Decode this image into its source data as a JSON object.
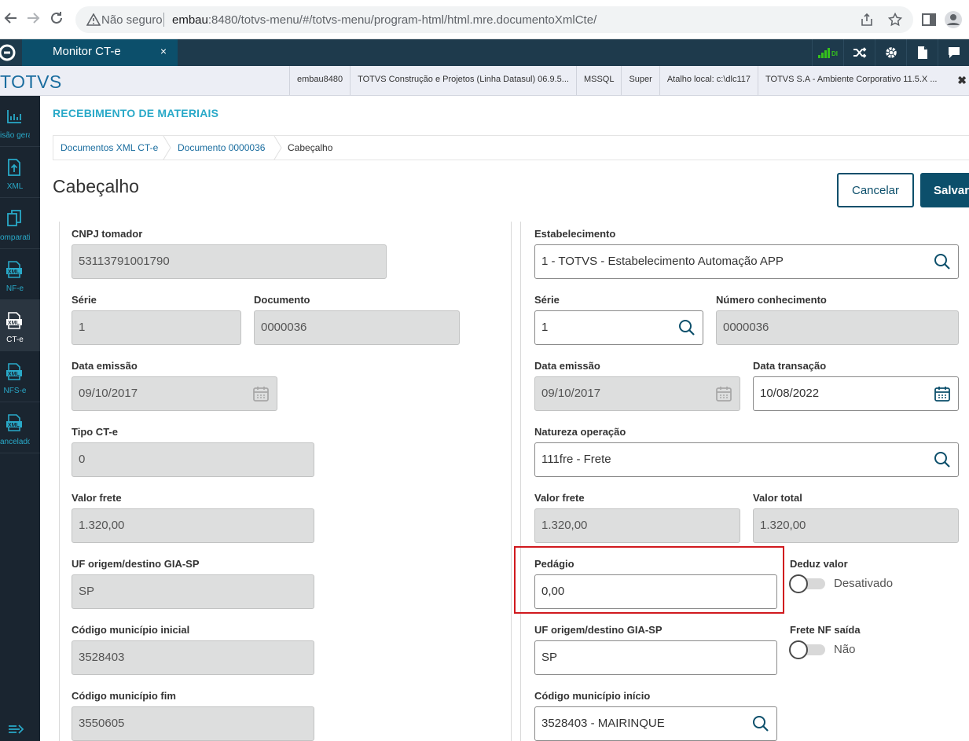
{
  "browser": {
    "insecure_label": "Não seguro",
    "url_host": "embau",
    "url_rest": ":8480/totvs-menu/#/totvs-menu/program-html/html.mre.documentoXmlCte/"
  },
  "header": {
    "tab_label": "Monitor CT-e",
    "tab_close": "×"
  },
  "infobar": {
    "logo": "TOTVS",
    "items": [
      "embau8480",
      "TOTVS Construção e Projetos (Linha Datasul) 06.9.5...",
      "MSSQL",
      "Super",
      "Atalho local: c:\\dlc117",
      "TOTVS S.A - Ambiente Corporativo 11.5.X ..."
    ],
    "close": "✖"
  },
  "sidebar": {
    "items": [
      {
        "label": "isão geral",
        "icon": "chart-icon"
      },
      {
        "label": "XML",
        "icon": "upload-icon"
      },
      {
        "label": "omparativo",
        "icon": "copy-icon"
      },
      {
        "label": "NF-e",
        "icon": "xml-file-icon"
      },
      {
        "label": "CT-e",
        "icon": "xml-file-icon"
      },
      {
        "label": "NFS-e",
        "icon": "xml-file-icon"
      },
      {
        "label": "ancelados",
        "icon": "xml-file-icon"
      }
    ]
  },
  "page": {
    "module_title": "RECEBIMENTO DE MATERIAIS",
    "breadcrumb": [
      "Documentos XML CT-e",
      "Documento 0000036",
      "Cabeçalho"
    ],
    "title": "Cabeçalho",
    "cancel_label": "Cancelar",
    "save_label": "Salvar"
  },
  "left": {
    "cnpj_label": "CNPJ tomador",
    "cnpj_value": "53113791001790",
    "serie_label": "Série",
    "serie_value": "1",
    "documento_label": "Documento",
    "documento_value": "0000036",
    "data_emissao_label": "Data emissão",
    "data_emissao_value": "09/10/2017",
    "tipo_cte_label": "Tipo CT-e",
    "tipo_cte_value": "0",
    "valor_frete_label": "Valor frete",
    "valor_frete_value": "1.320,00",
    "uf_label": "UF origem/destino GIA-SP",
    "uf_value": "SP",
    "cod_mun_ini_label": "Código município inicial",
    "cod_mun_ini_value": "3528403",
    "cod_mun_fim_label": "Código município fim",
    "cod_mun_fim_value": "3550605"
  },
  "right": {
    "estab_label": "Estabelecimento",
    "estab_value": "1 - TOTVS - Estabelecimento Automação APP",
    "serie_label": "Série",
    "serie_value": "1",
    "num_conh_label": "Número conhecimento",
    "num_conh_value": "0000036",
    "data_emissao_label": "Data emissão",
    "data_emissao_value": "09/10/2017",
    "data_transacao_label": "Data transação",
    "data_transacao_value": "10/08/2022",
    "natureza_label": "Natureza operação",
    "natureza_value": "111fre - Frete",
    "valor_frete_label": "Valor frete",
    "valor_frete_value": "1.320,00",
    "valor_total_label": "Valor total",
    "valor_total_value": "1.320,00",
    "pedagio_label": "Pedágio",
    "pedagio_value": "0,00",
    "deduz_label": "Deduz valor",
    "deduz_state": "Desativado",
    "uf_label": "UF origem/destino GIA-SP",
    "uf_value": "SP",
    "frete_nf_label": "Frete NF saída",
    "frete_nf_state": "Não",
    "cod_mun_ini_label": "Código município início",
    "cod_mun_ini_value": "3528403 - MAIRINQUE"
  },
  "colors": {
    "accent": "#29a9c8",
    "primary": "#0c4f6b",
    "header": "#1e3a4c",
    "sidebar": "#1a2530",
    "highlight": "#d0191e"
  }
}
